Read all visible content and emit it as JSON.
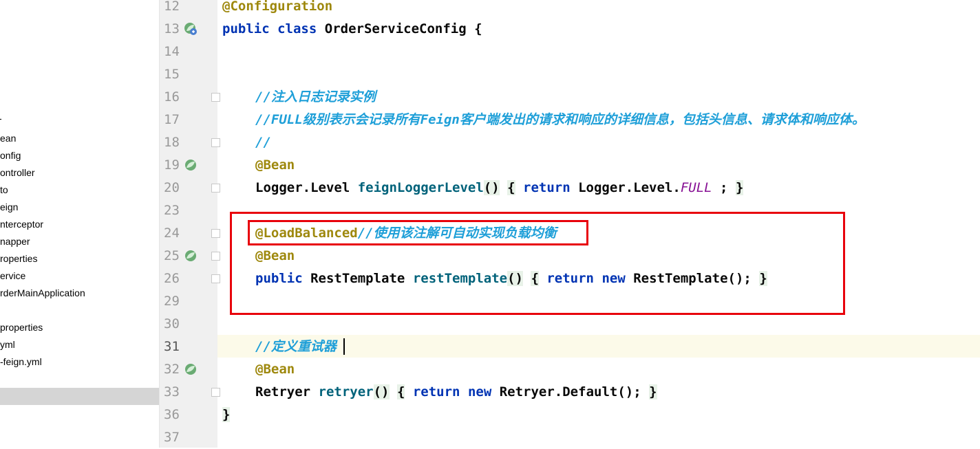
{
  "sidebar": {
    "items": [
      {
        "label": "-"
      },
      {
        "label": "ean"
      },
      {
        "label": "onfig"
      },
      {
        "label": "ontroller"
      },
      {
        "label": "to"
      },
      {
        "label": "eign"
      },
      {
        "label": "nterceptor"
      },
      {
        "label": "napper"
      },
      {
        "label": "roperties"
      },
      {
        "label": "ervice"
      },
      {
        "label": "rderMainApplication"
      },
      {
        "label": "properties"
      },
      {
        "label": "yml"
      },
      {
        "label": "-feign.yml"
      }
    ]
  },
  "editor": {
    "lines": [
      {
        "num": "12"
      },
      {
        "num": "13"
      },
      {
        "num": "14"
      },
      {
        "num": "15"
      },
      {
        "num": "16"
      },
      {
        "num": "17"
      },
      {
        "num": "18"
      },
      {
        "num": "19"
      },
      {
        "num": "20"
      },
      {
        "num": "23"
      },
      {
        "num": "24"
      },
      {
        "num": "25"
      },
      {
        "num": "26"
      },
      {
        "num": "29"
      },
      {
        "num": "30"
      },
      {
        "num": "31"
      },
      {
        "num": "32"
      },
      {
        "num": "33"
      },
      {
        "num": "36"
      },
      {
        "num": "37"
      }
    ],
    "code": {
      "l12_ann": "@Configuration",
      "l13_kw1": "public",
      "l13_kw2": "class",
      "l13_name": "OrderServiceConfig",
      "l13_brace": "{",
      "l16_comment": "//注入日志记录实例",
      "l17_comment": "//FULL级别表示会记录所有Feign客户端发出的请求和响应的详细信息，包括头信息、请求体和响应体。",
      "l18_comment": "//",
      "l19_ann": "@Bean",
      "l20_type": "Logger.Level",
      "l20_fn": "feignLoggerLevel",
      "l20_parens": "()",
      "l20_open": "{",
      "l20_return": "return",
      "l20_expr": "Logger.Level.",
      "l20_field": "FULL",
      "l20_semi": " ;",
      "l20_close": "}",
      "l24_ann": "@LoadBalanced",
      "l24_comment": "//使用该注解可自动实现负载均衡",
      "l25_ann": "@Bean",
      "l26_kw": "public",
      "l26_type": "RestTemplate",
      "l26_fn": "restTemplate",
      "l26_parens": "()",
      "l26_open": "{",
      "l26_return": "return",
      "l26_new": "new",
      "l26_expr": "RestTemplate",
      "l26_call": "()",
      "l26_semi": ";",
      "l26_close": "}",
      "l31_comment": "//定义重试器",
      "l32_ann": "@Bean",
      "l33_type": "Retryer",
      "l33_fn": "retryer",
      "l33_parens": "()",
      "l33_open": "{",
      "l33_return": "return",
      "l33_new": "new",
      "l33_expr": "Retryer.Default",
      "l33_call": "()",
      "l33_semi": ";",
      "l33_close": "}",
      "l36_brace": "}"
    }
  },
  "colors": {
    "keyword": "#0033b3",
    "annotation": "#9e880d",
    "method": "#00627a",
    "comment": "#1e9fd8",
    "highlight_box": "#e8000b"
  }
}
